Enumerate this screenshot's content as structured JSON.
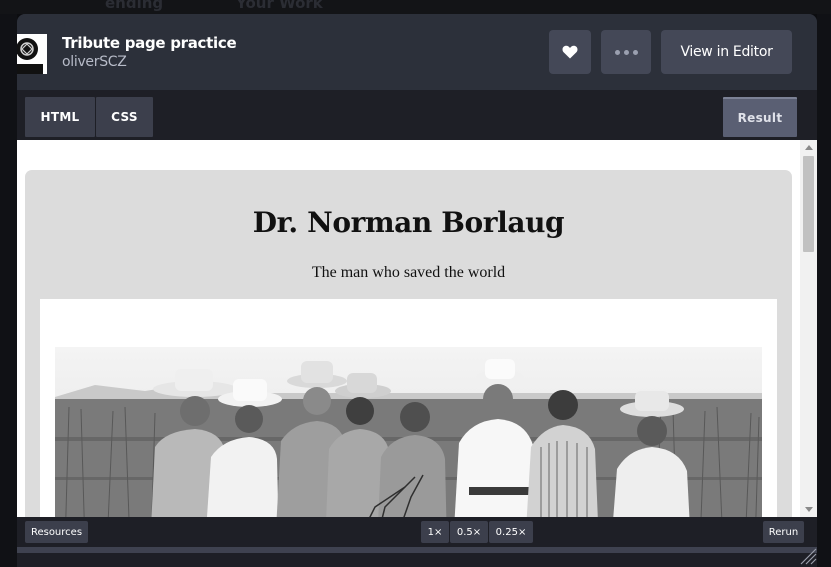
{
  "background": {
    "partial_tabs": [
      "ending",
      "Your Work"
    ]
  },
  "header": {
    "title": "Tribute page practice",
    "author": "oliverSCZ",
    "heart_icon": "heart-icon",
    "more_icon": "more-dots-icon",
    "view_in_editor": "View in Editor"
  },
  "tabs": {
    "html": "HTML",
    "css": "CSS",
    "result": "Result"
  },
  "result": {
    "heading": "Dr. Norman Borlaug",
    "subtitle": "The man who saved the world"
  },
  "footer": {
    "resources": "Resources",
    "zoom_options": [
      "1×",
      "0.5×",
      "0.25×"
    ],
    "rerun": "Rerun"
  },
  "colors": {
    "header_bg": "#2c303a",
    "button_bg": "#444857",
    "panel_bg": "#1e1f26",
    "card_bg": "#dcdcdc"
  }
}
